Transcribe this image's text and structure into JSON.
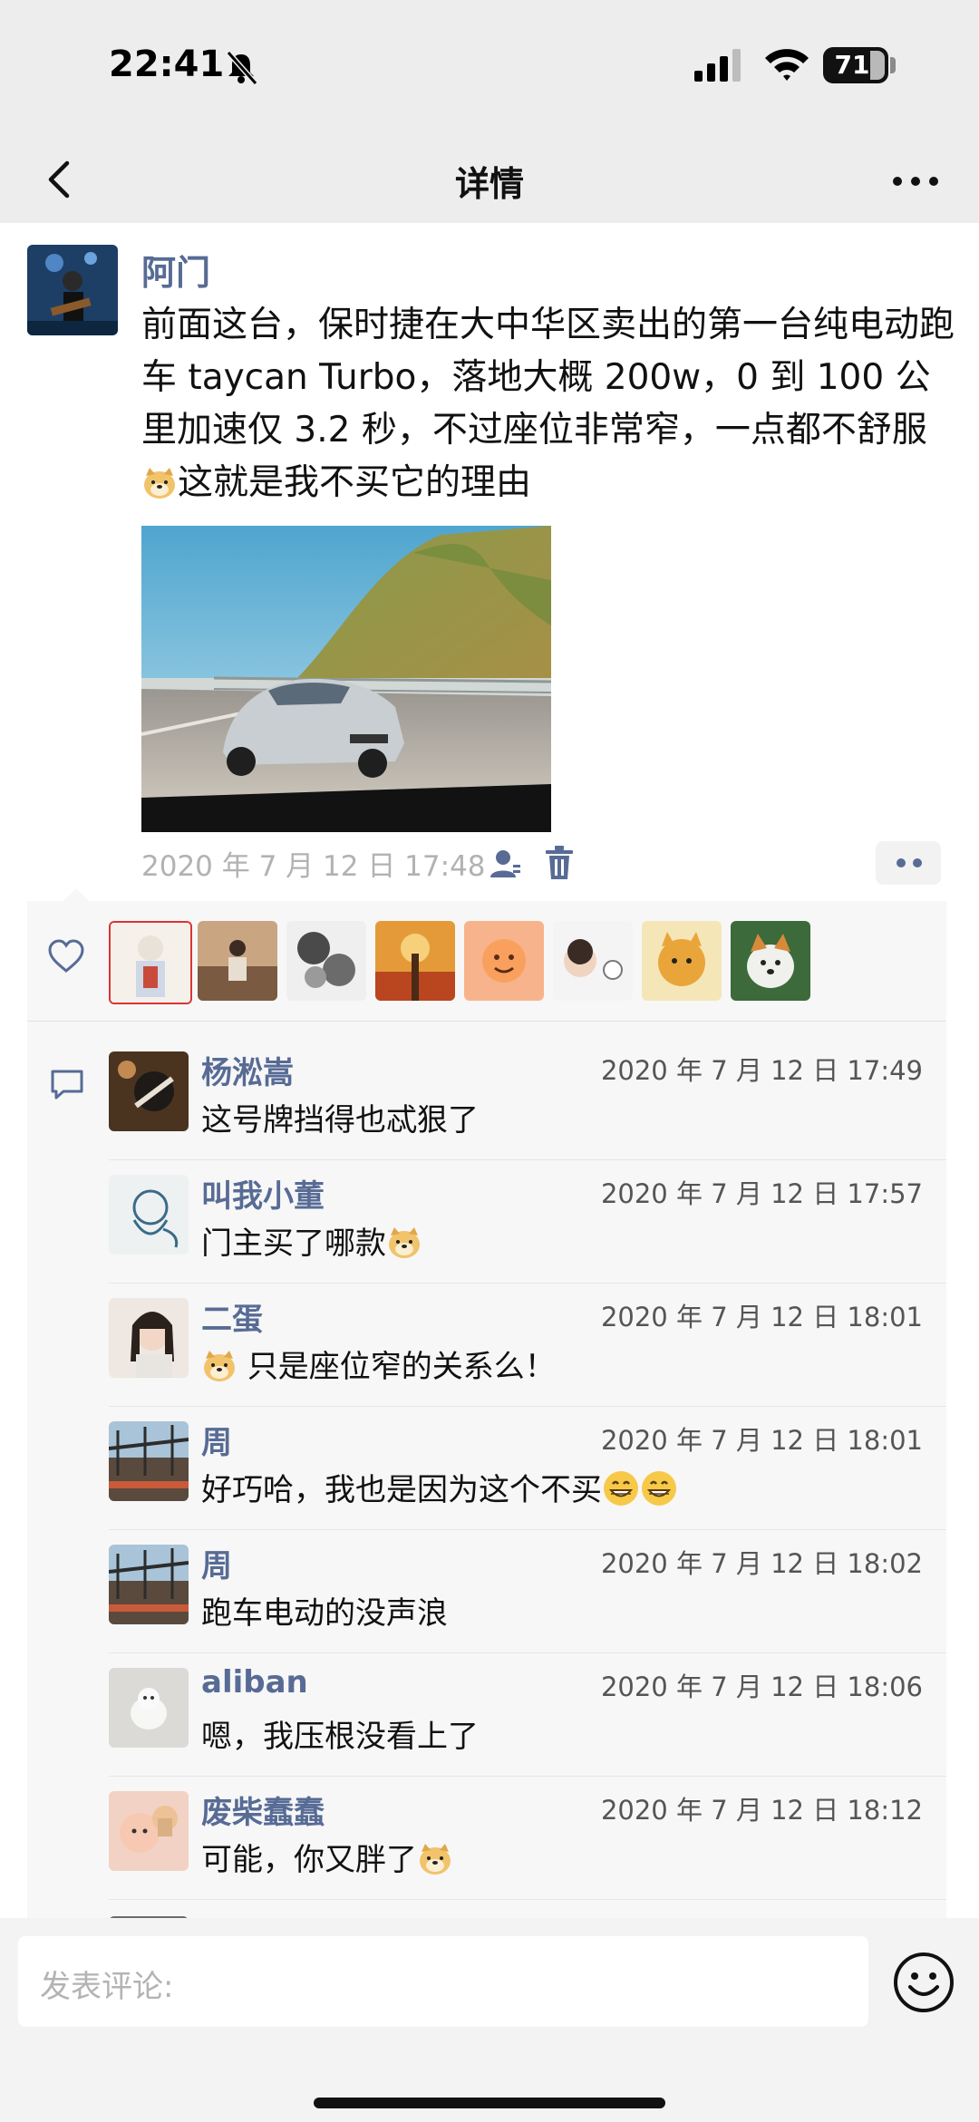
{
  "status_bar": {
    "time": "22:41",
    "battery": "71"
  },
  "nav": {
    "title": "详情"
  },
  "post": {
    "author": "阿门",
    "text": "前面这台，保时捷在大中华区卖出的第一台纯电动跑车 taycan Turbo，落地大概 200w，0 到 100 公里加速仅 3.2 秒，不过座位非常窄，一点都不舒服",
    "text_tail": "这就是我不买它的理由",
    "timestamp": "2020 年 7 月 12 日 17:48"
  },
  "likes": {
    "count_shown": 8
  },
  "comments": [
    {
      "name": "杨淞嵩",
      "time": "2020 年 7 月 12 日 17:49",
      "text": "这号牌挡得也忒狠了"
    },
    {
      "name": "叫我小董",
      "time": "2020 年 7 月 12 日 17:57",
      "text": "门主买了哪款"
    },
    {
      "name": "二蛋",
      "time": "2020 年 7 月 12 日 18:01",
      "text": "只是座位窄的关系么！"
    },
    {
      "name": "周",
      "time": "2020 年 7 月 12 日 18:01",
      "text": "好巧哈，我也是因为这个不买"
    },
    {
      "name": "周",
      "time": "2020 年 7 月 12 日 18:02",
      "text": "跑车电动的没声浪"
    },
    {
      "name": "aliban",
      "time": "2020 年 7 月 12 日 18:06",
      "text": "嗯，我压根没看上了"
    },
    {
      "name": "废柴蠢蠢",
      "time": "2020 年 7 月 12 日 18:12",
      "text": "可能，你又胖了"
    }
  ],
  "input": {
    "placeholder": "发表评论:"
  },
  "colors": {
    "link_blue": "#576b95",
    "bar_gray": "#ededed",
    "panel_gray": "#f7f7f7"
  }
}
